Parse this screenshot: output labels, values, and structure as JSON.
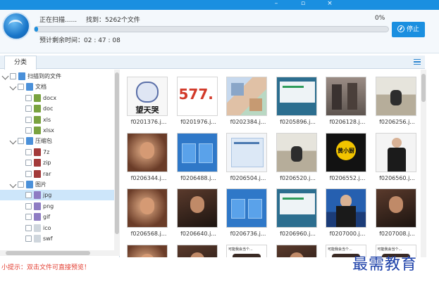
{
  "scan": {
    "status": "正在扫描......",
    "found_label": "找到：5262个文件",
    "percent_label": "0%",
    "progress": 0.01,
    "eta_label": "预计剩余时间：02 : 47 : 08",
    "stop_label": "停止"
  },
  "panel": {
    "tab_label": "分类"
  },
  "tree": [
    {
      "label": "扫描到的文件",
      "icon": "folder-icon",
      "level": 0,
      "expanded": true
    },
    {
      "label": "文档",
      "icon": "document-folder-icon",
      "level": 1,
      "expanded": true
    },
    {
      "label": "docx",
      "icon": "word-doc-icon",
      "level": 2
    },
    {
      "label": "doc",
      "icon": "word-doc-icon",
      "level": 2
    },
    {
      "label": "xls",
      "icon": "excel-icon",
      "level": 2
    },
    {
      "label": "xlsx",
      "icon": "excel-icon",
      "level": 2
    },
    {
      "label": "压缩包",
      "icon": "archive-folder-icon",
      "level": 1,
      "expanded": true
    },
    {
      "label": "7z",
      "icon": "archive-icon",
      "level": 2
    },
    {
      "label": "zip",
      "icon": "archive-icon",
      "level": 2
    },
    {
      "label": "rar",
      "icon": "archive-icon",
      "level": 2
    },
    {
      "label": "图片",
      "icon": "image-folder-icon",
      "level": 1,
      "expanded": true
    },
    {
      "label": "jpg",
      "icon": "image-icon",
      "level": 2,
      "selected": true
    },
    {
      "label": "png",
      "icon": "image-icon",
      "level": 2
    },
    {
      "label": "gif",
      "icon": "image-icon",
      "level": 2
    },
    {
      "label": "ico",
      "icon": "file-icon",
      "level": 2
    },
    {
      "label": "swf",
      "icon": "file-icon",
      "level": 2
    }
  ],
  "files": [
    {
      "name": "f0201376.j...",
      "art": "face"
    },
    {
      "name": "f0201976.j...",
      "art": "text577"
    },
    {
      "name": "f0202384.j...",
      "art": "collage"
    },
    {
      "name": "f0205896.j...",
      "art": "web"
    },
    {
      "name": "f0206128.j...",
      "art": "gray"
    },
    {
      "name": "f0206256.j...",
      "art": "outdoor"
    },
    {
      "name": "f0206344.j...",
      "art": "warm"
    },
    {
      "name": "f0206488.j...",
      "art": "blueui"
    },
    {
      "name": "f0206504.j...",
      "art": "doc"
    },
    {
      "name": "f0206520.j...",
      "art": "outdoor"
    },
    {
      "name": "f0206552.j...",
      "art": "logo"
    },
    {
      "name": "f0206560.j...",
      "art": "person"
    },
    {
      "name": "f0206568.j...",
      "art": "warm"
    },
    {
      "name": "f0206640.j...",
      "art": "dark"
    },
    {
      "name": "f0206736.j...",
      "art": "blueui"
    },
    {
      "name": "f0206960.j...",
      "art": "web"
    },
    {
      "name": "f0207000.j...",
      "art": "anchor"
    },
    {
      "name": "f0207008.j...",
      "art": "dark"
    },
    {
      "name": "",
      "art": "warm"
    },
    {
      "name": "",
      "art": "dark"
    },
    {
      "name": "",
      "art": "textwhite"
    },
    {
      "name": "",
      "art": "dark"
    },
    {
      "name": "",
      "art": "textwhite"
    },
    {
      "name": "",
      "art": "textwhite"
    }
  ],
  "thumb_texts": {
    "t577": "577.",
    "face_caption": "望天哭",
    "logo_caption": "黄小厨",
    "header_text": "可能我会当个..."
  },
  "footer": {
    "tip": "小提示：双击文件可直接预览！",
    "watermark": "最需教育"
  },
  "colors": {
    "accent": "#1a8fe0",
    "tip_text": "#e23b2e",
    "watermark": "#1b3fa8"
  }
}
